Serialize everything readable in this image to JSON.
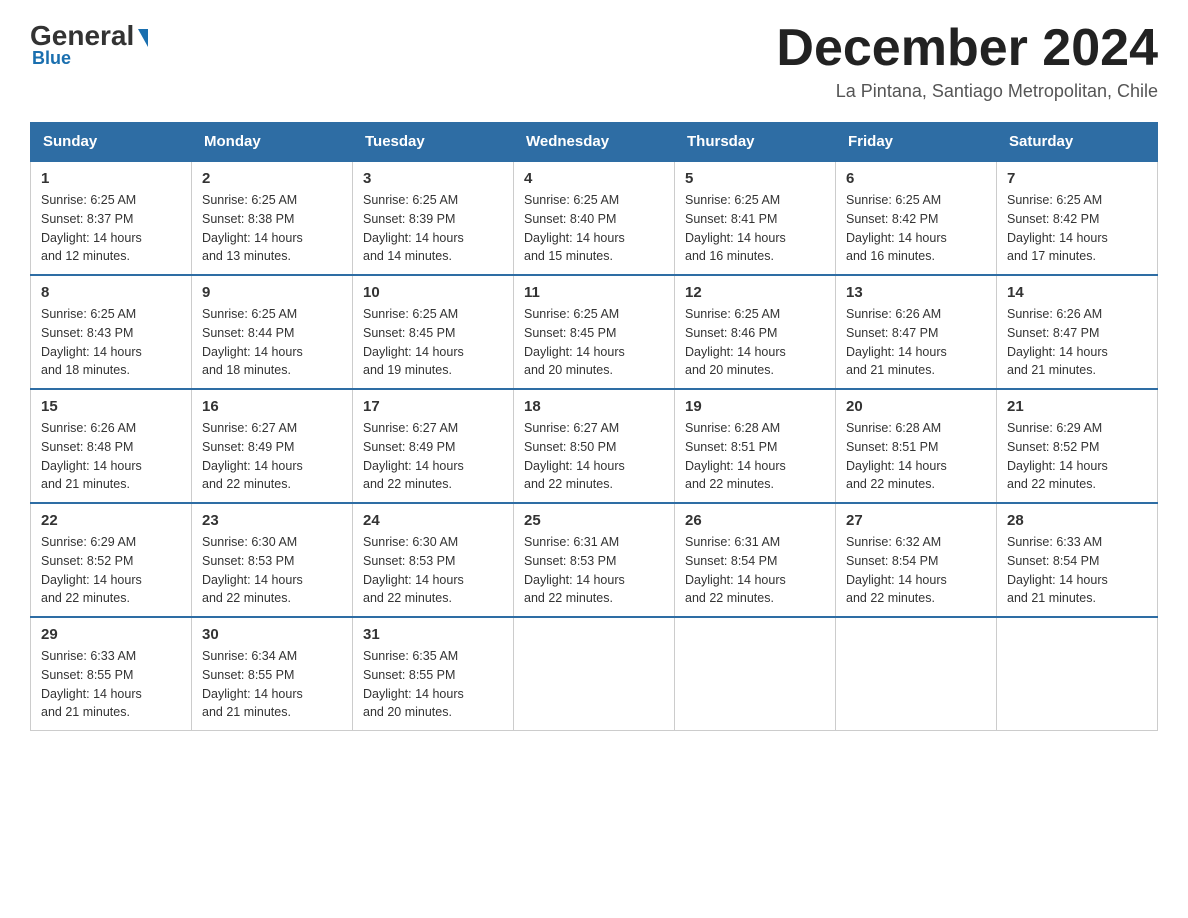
{
  "header": {
    "logo": {
      "general": "General",
      "blue": "Blue",
      "subtitle": "Blue"
    },
    "title": "December 2024",
    "location": "La Pintana, Santiago Metropolitan, Chile"
  },
  "weekdays": [
    "Sunday",
    "Monday",
    "Tuesday",
    "Wednesday",
    "Thursday",
    "Friday",
    "Saturday"
  ],
  "weeks": [
    [
      {
        "day": 1,
        "sunrise": "6:25 AM",
        "sunset": "8:37 PM",
        "daylight_h": 14,
        "daylight_m": 12
      },
      {
        "day": 2,
        "sunrise": "6:25 AM",
        "sunset": "8:38 PM",
        "daylight_h": 14,
        "daylight_m": 13
      },
      {
        "day": 3,
        "sunrise": "6:25 AM",
        "sunset": "8:39 PM",
        "daylight_h": 14,
        "daylight_m": 14
      },
      {
        "day": 4,
        "sunrise": "6:25 AM",
        "sunset": "8:40 PM",
        "daylight_h": 14,
        "daylight_m": 15
      },
      {
        "day": 5,
        "sunrise": "6:25 AM",
        "sunset": "8:41 PM",
        "daylight_h": 14,
        "daylight_m": 16
      },
      {
        "day": 6,
        "sunrise": "6:25 AM",
        "sunset": "8:42 PM",
        "daylight_h": 14,
        "daylight_m": 16
      },
      {
        "day": 7,
        "sunrise": "6:25 AM",
        "sunset": "8:42 PM",
        "daylight_h": 14,
        "daylight_m": 17
      }
    ],
    [
      {
        "day": 8,
        "sunrise": "6:25 AM",
        "sunset": "8:43 PM",
        "daylight_h": 14,
        "daylight_m": 18
      },
      {
        "day": 9,
        "sunrise": "6:25 AM",
        "sunset": "8:44 PM",
        "daylight_h": 14,
        "daylight_m": 18
      },
      {
        "day": 10,
        "sunrise": "6:25 AM",
        "sunset": "8:45 PM",
        "daylight_h": 14,
        "daylight_m": 19
      },
      {
        "day": 11,
        "sunrise": "6:25 AM",
        "sunset": "8:45 PM",
        "daylight_h": 14,
        "daylight_m": 20
      },
      {
        "day": 12,
        "sunrise": "6:25 AM",
        "sunset": "8:46 PM",
        "daylight_h": 14,
        "daylight_m": 20
      },
      {
        "day": 13,
        "sunrise": "6:26 AM",
        "sunset": "8:47 PM",
        "daylight_h": 14,
        "daylight_m": 21
      },
      {
        "day": 14,
        "sunrise": "6:26 AM",
        "sunset": "8:47 PM",
        "daylight_h": 14,
        "daylight_m": 21
      }
    ],
    [
      {
        "day": 15,
        "sunrise": "6:26 AM",
        "sunset": "8:48 PM",
        "daylight_h": 14,
        "daylight_m": 21
      },
      {
        "day": 16,
        "sunrise": "6:27 AM",
        "sunset": "8:49 PM",
        "daylight_h": 14,
        "daylight_m": 22
      },
      {
        "day": 17,
        "sunrise": "6:27 AM",
        "sunset": "8:49 PM",
        "daylight_h": 14,
        "daylight_m": 22
      },
      {
        "day": 18,
        "sunrise": "6:27 AM",
        "sunset": "8:50 PM",
        "daylight_h": 14,
        "daylight_m": 22
      },
      {
        "day": 19,
        "sunrise": "6:28 AM",
        "sunset": "8:51 PM",
        "daylight_h": 14,
        "daylight_m": 22
      },
      {
        "day": 20,
        "sunrise": "6:28 AM",
        "sunset": "8:51 PM",
        "daylight_h": 14,
        "daylight_m": 22
      },
      {
        "day": 21,
        "sunrise": "6:29 AM",
        "sunset": "8:52 PM",
        "daylight_h": 14,
        "daylight_m": 22
      }
    ],
    [
      {
        "day": 22,
        "sunrise": "6:29 AM",
        "sunset": "8:52 PM",
        "daylight_h": 14,
        "daylight_m": 22
      },
      {
        "day": 23,
        "sunrise": "6:30 AM",
        "sunset": "8:53 PM",
        "daylight_h": 14,
        "daylight_m": 22
      },
      {
        "day": 24,
        "sunrise": "6:30 AM",
        "sunset": "8:53 PM",
        "daylight_h": 14,
        "daylight_m": 22
      },
      {
        "day": 25,
        "sunrise": "6:31 AM",
        "sunset": "8:53 PM",
        "daylight_h": 14,
        "daylight_m": 22
      },
      {
        "day": 26,
        "sunrise": "6:31 AM",
        "sunset": "8:54 PM",
        "daylight_h": 14,
        "daylight_m": 22
      },
      {
        "day": 27,
        "sunrise": "6:32 AM",
        "sunset": "8:54 PM",
        "daylight_h": 14,
        "daylight_m": 22
      },
      {
        "day": 28,
        "sunrise": "6:33 AM",
        "sunset": "8:54 PM",
        "daylight_h": 14,
        "daylight_m": 21
      }
    ],
    [
      {
        "day": 29,
        "sunrise": "6:33 AM",
        "sunset": "8:55 PM",
        "daylight_h": 14,
        "daylight_m": 21
      },
      {
        "day": 30,
        "sunrise": "6:34 AM",
        "sunset": "8:55 PM",
        "daylight_h": 14,
        "daylight_m": 21
      },
      {
        "day": 31,
        "sunrise": "6:35 AM",
        "sunset": "8:55 PM",
        "daylight_h": 14,
        "daylight_m": 20
      },
      null,
      null,
      null,
      null
    ]
  ],
  "labels": {
    "sunrise": "Sunrise:",
    "sunset": "Sunset:",
    "daylight": "Daylight:"
  }
}
